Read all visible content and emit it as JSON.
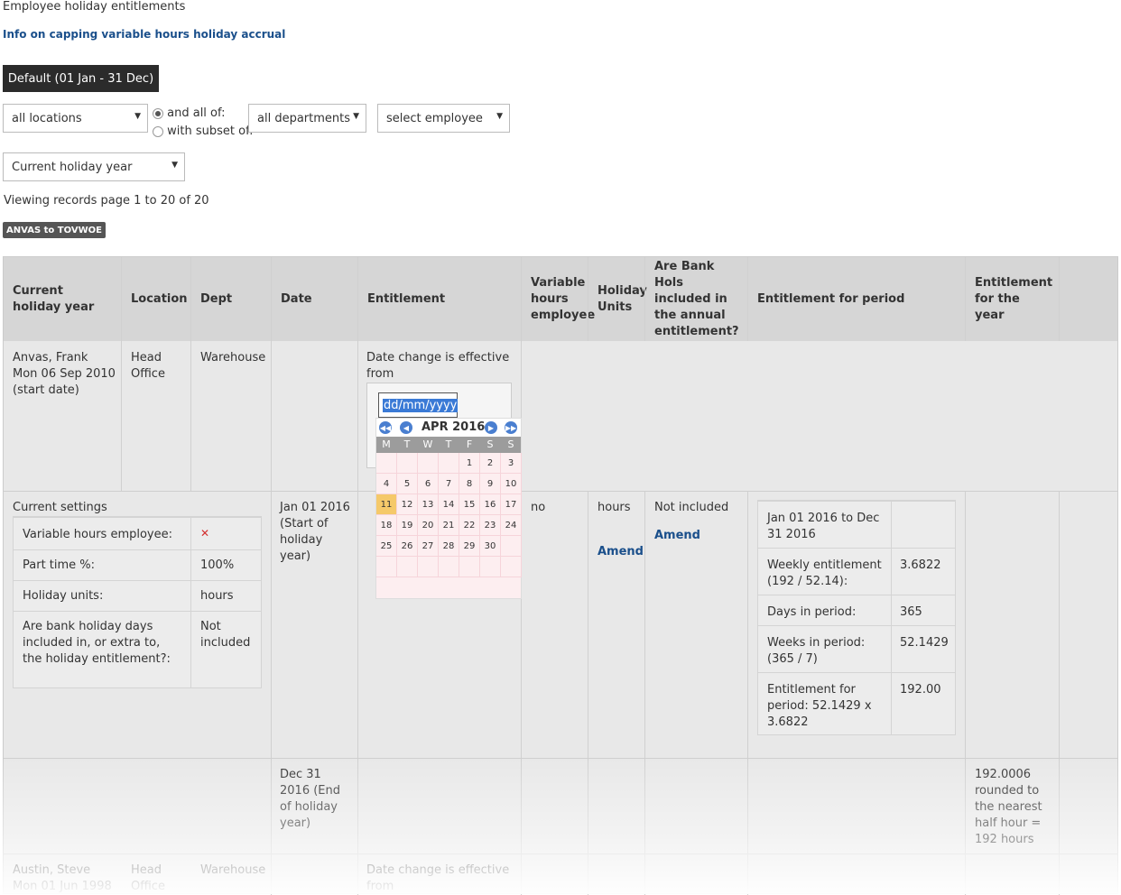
{
  "page_title": "Employee holiday entitlements",
  "info_link": "Info on capping variable hours holiday accrual",
  "period_button": "Default (01 Jan - 31 Dec)",
  "filters": {
    "location": "all locations",
    "radio_all": "and all of:",
    "radio_subset": "with subset of:",
    "department": "all departments",
    "employee": "select employee",
    "holiday_year": "Current holiday year"
  },
  "viewing": "Viewing records page 1 to 20 of 20",
  "range_button": "ANVAS to TOVWOE",
  "columns": {
    "c1": "Current holiday year",
    "c2": "Location",
    "c3": "Dept",
    "c4": "Date",
    "c5": "Entitlement",
    "c6": "Variable hours employee",
    "c7": "Holiday Units",
    "c8": "Are Bank Hols included in the annual entitlement?",
    "c9": "Entitlement for period",
    "c10": "Entitlement for the year"
  },
  "row1": {
    "name": "Anvas, Frank",
    "start": "Mon 06 Sep 2010",
    "start_note": "(start date)",
    "location": "Head Office",
    "dept": "Warehouse",
    "date_change": "Date change is effective from",
    "date_placeholder": "dd/mm/yyyy"
  },
  "calendar": {
    "title": "APR 2016",
    "dow": [
      "M",
      "T",
      "W",
      "T",
      "F",
      "S",
      "S"
    ],
    "days": [
      "1",
      "2",
      "3",
      "4",
      "5",
      "6",
      "7",
      "8",
      "9",
      "10",
      "11",
      "12",
      "13",
      "14",
      "15",
      "16",
      "17",
      "18",
      "19",
      "20",
      "21",
      "22",
      "23",
      "24",
      "25",
      "26",
      "27",
      "28",
      "29",
      "30"
    ],
    "today": "11"
  },
  "settings": {
    "heading": "Current settings",
    "variable_label": "Variable hours employee:",
    "parttime_label": "Part time %:",
    "parttime_value": "100%",
    "units_label": "Holiday units:",
    "units_value": "hours",
    "bank_label": "Are bank holiday days included in, or extra to, the holiday entitlement?:",
    "bank_value": "Not included"
  },
  "row2": {
    "date": "Jan 01 2016 (Start of holiday year)",
    "variable": "no",
    "units": "hours",
    "amend1": "Amend",
    "bank": "Not included",
    "amend2": "Amend"
  },
  "period": {
    "range": "Jan 01 2016 to Dec 31 2016",
    "weekly_label": "Weekly entitlement (192 / 52.14):",
    "weekly_value": "3.6822",
    "days_label": "Days in period:",
    "days_value": "365",
    "weeks_label": "Weeks in period: (365 / 7)",
    "weeks_value": "52.1429",
    "ent_label": "Entitlement for period: 52.1429 x 3.6822",
    "ent_value": "192.00"
  },
  "row3": {
    "date": "Dec 31 2016 (End of holiday year)",
    "year_total": "192.0006 rounded to the nearest half hour = 192 hours"
  },
  "row4": {
    "name": "Austin, Steve",
    "start": "Mon 01 Jun 1998",
    "location": "Head Office",
    "dept": "Warehouse",
    "date_change": "Date change is effective from"
  }
}
